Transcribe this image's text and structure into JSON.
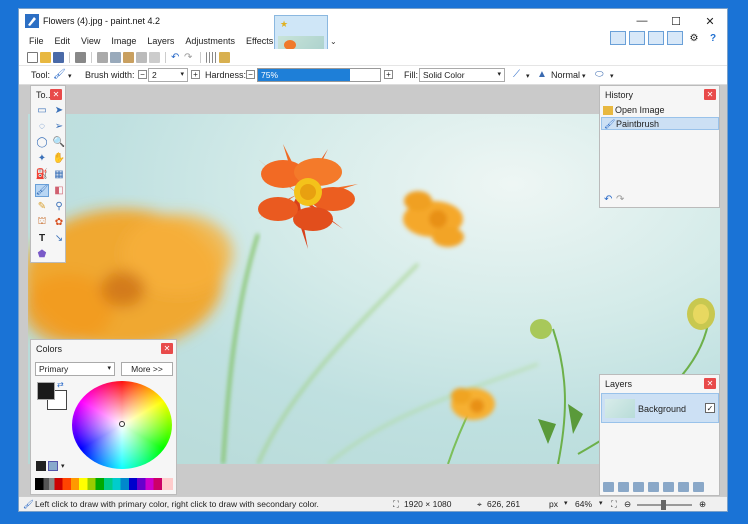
{
  "window": {
    "title": "Flowers (4).jpg - paint.net 4.2",
    "controls": {
      "minimize": "—",
      "maximize": "☐",
      "close": "✕"
    }
  },
  "menu": [
    "File",
    "Edit",
    "View",
    "Image",
    "Layers",
    "Adjustments",
    "Effects"
  ],
  "toolbar": {
    "tool_label": "Tool:",
    "brush_width_label": "Brush width:",
    "brush_width_value": "2",
    "hardness_label": "Hardness:",
    "hardness_value": "75%",
    "hardness_fraction": 0.75,
    "fill_label": "Fill:",
    "fill_value": "Solid Color",
    "blend_mode": "Normal"
  },
  "tools_panel": {
    "title": "To..."
  },
  "history_panel": {
    "title": "History",
    "items": [
      {
        "label": "Open Image",
        "selected": false
      },
      {
        "label": "Paintbrush",
        "selected": true
      }
    ]
  },
  "colors_panel": {
    "title": "Colors",
    "mode": "Primary",
    "more_button": "More >>"
  },
  "layers_panel": {
    "title": "Layers",
    "layers": [
      {
        "name": "Background",
        "visible": true
      }
    ]
  },
  "status": {
    "hint": "Left click to draw with primary color, right click to draw with secondary color.",
    "image_size": "1920 × 1080",
    "cursor": "626, 261",
    "units": "px",
    "zoom": "64%"
  },
  "colors": {
    "accent": "#1e7fd8",
    "primary_color": "#1a1a1a",
    "secondary_color": "#ffffff"
  }
}
